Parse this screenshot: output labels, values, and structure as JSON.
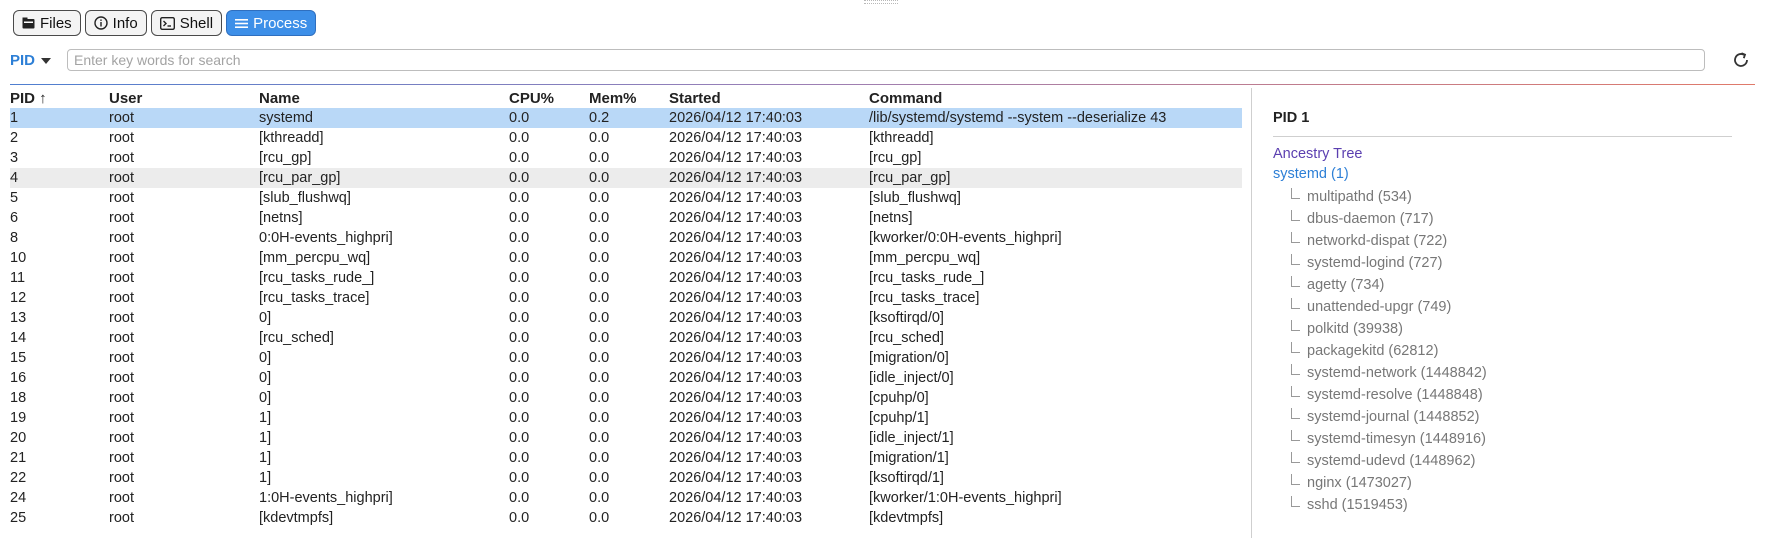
{
  "tabs": [
    {
      "label": "Files",
      "icon": "folder-icon"
    },
    {
      "label": "Info",
      "icon": "info-icon"
    },
    {
      "label": "Shell",
      "icon": "terminal-icon"
    },
    {
      "label": "Process",
      "icon": "list-icon",
      "active": true
    }
  ],
  "search": {
    "filter_label": "PID",
    "placeholder": "Enter key words for search"
  },
  "table": {
    "headers": {
      "pid": "PID ↑",
      "user": "User",
      "name": "Name",
      "cpu": "CPU%",
      "mem": "Mem%",
      "started": "Started",
      "command": "Command"
    },
    "rows": [
      {
        "pid": "1",
        "user": "root",
        "name": "systemd",
        "cpu": "0.0",
        "mem": "0.2",
        "started": "2026/04/12 17:40:03",
        "command": "/lib/systemd/systemd --system --deserialize 43"
      },
      {
        "pid": "2",
        "user": "root",
        "name": "[kthreadd]",
        "cpu": "0.0",
        "mem": "0.0",
        "started": "2026/04/12 17:40:03",
        "command": "[kthreadd]"
      },
      {
        "pid": "3",
        "user": "root",
        "name": "[rcu_gp]",
        "cpu": "0.0",
        "mem": "0.0",
        "started": "2026/04/12 17:40:03",
        "command": "[rcu_gp]"
      },
      {
        "pid": "4",
        "user": "root",
        "name": "[rcu_par_gp]",
        "cpu": "0.0",
        "mem": "0.0",
        "started": "2026/04/12 17:40:03",
        "command": "[rcu_par_gp]"
      },
      {
        "pid": "5",
        "user": "root",
        "name": "[slub_flushwq]",
        "cpu": "0.0",
        "mem": "0.0",
        "started": "2026/04/12 17:40:03",
        "command": "[slub_flushwq]"
      },
      {
        "pid": "6",
        "user": "root",
        "name": "[netns]",
        "cpu": "0.0",
        "mem": "0.0",
        "started": "2026/04/12 17:40:03",
        "command": "[netns]"
      },
      {
        "pid": "8",
        "user": "root",
        "name": "0:0H-events_highpri]",
        "cpu": "0.0",
        "mem": "0.0",
        "started": "2026/04/12 17:40:03",
        "command": "[kworker/0:0H-events_highpri]"
      },
      {
        "pid": "10",
        "user": "root",
        "name": "[mm_percpu_wq]",
        "cpu": "0.0",
        "mem": "0.0",
        "started": "2026/04/12 17:40:03",
        "command": "[mm_percpu_wq]"
      },
      {
        "pid": "11",
        "user": "root",
        "name": "[rcu_tasks_rude_]",
        "cpu": "0.0",
        "mem": "0.0",
        "started": "2026/04/12 17:40:03",
        "command": "[rcu_tasks_rude_]"
      },
      {
        "pid": "12",
        "user": "root",
        "name": "[rcu_tasks_trace]",
        "cpu": "0.0",
        "mem": "0.0",
        "started": "2026/04/12 17:40:03",
        "command": "[rcu_tasks_trace]"
      },
      {
        "pid": "13",
        "user": "root",
        "name": "0]",
        "cpu": "0.0",
        "mem": "0.0",
        "started": "2026/04/12 17:40:03",
        "command": "[ksoftirqd/0]"
      },
      {
        "pid": "14",
        "user": "root",
        "name": "[rcu_sched]",
        "cpu": "0.0",
        "mem": "0.0",
        "started": "2026/04/12 17:40:03",
        "command": "[rcu_sched]"
      },
      {
        "pid": "15",
        "user": "root",
        "name": "0]",
        "cpu": "0.0",
        "mem": "0.0",
        "started": "2026/04/12 17:40:03",
        "command": "[migration/0]"
      },
      {
        "pid": "16",
        "user": "root",
        "name": "0]",
        "cpu": "0.0",
        "mem": "0.0",
        "started": "2026/04/12 17:40:03",
        "command": "[idle_inject/0]"
      },
      {
        "pid": "18",
        "user": "root",
        "name": "0]",
        "cpu": "0.0",
        "mem": "0.0",
        "started": "2026/04/12 17:40:03",
        "command": "[cpuhp/0]"
      },
      {
        "pid": "19",
        "user": "root",
        "name": "1]",
        "cpu": "0.0",
        "mem": "0.0",
        "started": "2026/04/12 17:40:03",
        "command": "[cpuhp/1]"
      },
      {
        "pid": "20",
        "user": "root",
        "name": "1]",
        "cpu": "0.0",
        "mem": "0.0",
        "started": "2026/04/12 17:40:03",
        "command": "[idle_inject/1]"
      },
      {
        "pid": "21",
        "user": "root",
        "name": "1]",
        "cpu": "0.0",
        "mem": "0.0",
        "started": "2026/04/12 17:40:03",
        "command": "[migration/1]"
      },
      {
        "pid": "22",
        "user": "root",
        "name": "1]",
        "cpu": "0.0",
        "mem": "0.0",
        "started": "2026/04/12 17:40:03",
        "command": "[ksoftirqd/1]"
      },
      {
        "pid": "24",
        "user": "root",
        "name": "1:0H-events_highpri]",
        "cpu": "0.0",
        "mem": "0.0",
        "started": "2026/04/12 17:40:03",
        "command": "[kworker/1:0H-events_highpri]"
      },
      {
        "pid": "25",
        "user": "root",
        "name": "[kdevtmpfs]",
        "cpu": "0.0",
        "mem": "0.0",
        "started": "2026/04/12 17:40:03",
        "command": "[kdevtmpfs]"
      }
    ]
  },
  "detail": {
    "title": "PID 1",
    "ancestry_label": "Ancestry Tree",
    "root": "systemd (1)",
    "children": [
      "multipathd (534)",
      "dbus-daemon (717)",
      "networkd-dispat (722)",
      "systemd-logind (727)",
      "agetty (734)",
      "unattended-upgr (749)",
      "polkitd (39938)",
      "packagekitd (62812)",
      "systemd-network (1448842)",
      "systemd-resolve (1448848)",
      "systemd-journal (1448852)",
      "systemd-timesyn (1448916)",
      "systemd-udevd (1448962)",
      "nginx (1473027)",
      "sshd (1519453)"
    ]
  }
}
